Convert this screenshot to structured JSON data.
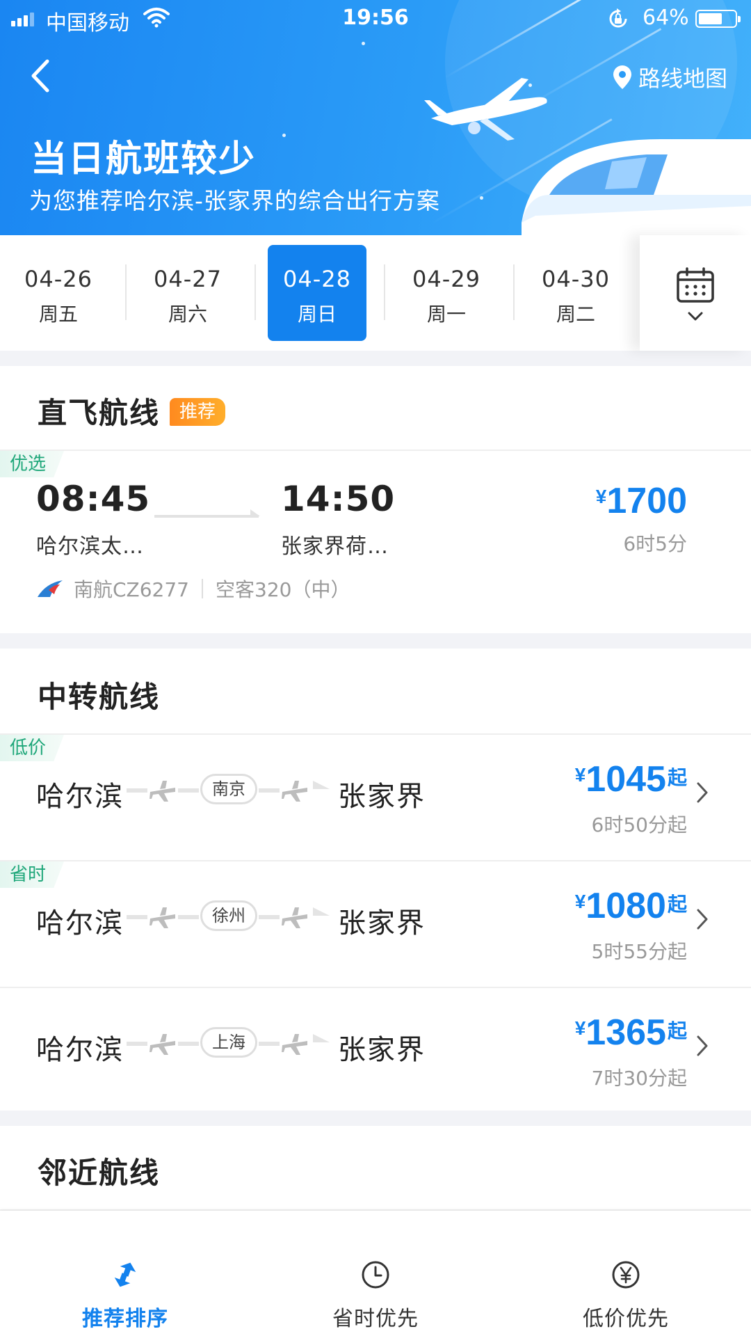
{
  "status_bar": {
    "carrier": "中国移动",
    "time": "19:56",
    "battery": "64%",
    "battery_level": 0.64
  },
  "header": {
    "route_map_label": "路线地图",
    "title": "当日航班较少",
    "subtitle": "为您推荐哈尔滨-张家界的综合出行方案"
  },
  "dates": [
    {
      "date": "04-26",
      "weekday": "周五",
      "selected": false
    },
    {
      "date": "04-27",
      "weekday": "周六",
      "selected": false
    },
    {
      "date": "04-28",
      "weekday": "周日",
      "selected": true
    },
    {
      "date": "04-29",
      "weekday": "周一",
      "selected": false
    },
    {
      "date": "04-30",
      "weekday": "周二",
      "selected": false
    }
  ],
  "direct": {
    "title": "直飞航线",
    "badge": "推荐",
    "tag": "优选",
    "depart_time": "08:45",
    "depart_airport": "哈尔滨太…",
    "arrive_time": "14:50",
    "arrive_airport": "张家界荷…",
    "currency": "¥",
    "price": "1700",
    "duration": "6时5分",
    "airline": "南航CZ6277",
    "aircraft": "空客320（中）"
  },
  "transfer": {
    "title": "中转航线",
    "rows": [
      {
        "tag": "低价",
        "from": "哈尔滨",
        "via": "南京",
        "to": "张家界",
        "currency": "¥",
        "price": "1045",
        "suffix": "起",
        "duration": "6时50分起"
      },
      {
        "tag": "省时",
        "from": "哈尔滨",
        "via": "徐州",
        "to": "张家界",
        "currency": "¥",
        "price": "1080",
        "suffix": "起",
        "duration": "5时55分起"
      },
      {
        "tag": "",
        "from": "哈尔滨",
        "via": "上海",
        "to": "张家界",
        "currency": "¥",
        "price": "1365",
        "suffix": "起",
        "duration": "7时30分起"
      }
    ]
  },
  "nearby": {
    "title": "邻近航线"
  },
  "bottom_nav": [
    {
      "label": "推荐排序",
      "icon": "sort-arrows-icon",
      "active": true
    },
    {
      "label": "省时优先",
      "icon": "clock-icon",
      "active": false
    },
    {
      "label": "低价优先",
      "icon": "yen-coin-icon",
      "active": false
    }
  ],
  "colors": {
    "accent": "#1382ee",
    "tag_green": "#1fa77a",
    "badge_orange": "#ff9a22"
  }
}
